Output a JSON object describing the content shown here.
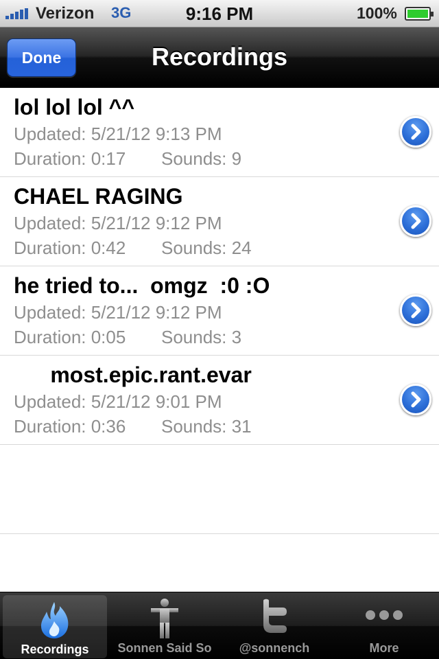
{
  "status_bar": {
    "carrier": "Verizon",
    "network": "3G",
    "time": "9:16 PM",
    "battery": "100%"
  },
  "nav": {
    "done_label": "Done",
    "title": "Recordings"
  },
  "recordings": [
    {
      "title": "lol lol lol ^^",
      "updated": "Updated: 5/21/12 9:13 PM",
      "duration": "Duration: 0:17",
      "sounds": "Sounds: 9"
    },
    {
      "title": "CHAEL RAGING",
      "updated": "Updated: 5/21/12 9:12 PM",
      "duration": "Duration: 0:42",
      "sounds": "Sounds: 24"
    },
    {
      "title": "he tried to...  omgz  :0 :O",
      "updated": "Updated: 5/21/12 9:12 PM",
      "duration": "Duration: 0:05",
      "sounds": "Sounds: 3"
    },
    {
      "title": "      most.epic.rant.evar",
      "updated": "Updated: 5/21/12 9:01 PM",
      "duration": "Duration: 0:36",
      "sounds": "Sounds: 31"
    }
  ],
  "tabs": [
    {
      "label": "Recordings",
      "icon": "flame-icon",
      "selected": true
    },
    {
      "label": "Sonnen Said So",
      "icon": "person-icon",
      "selected": false
    },
    {
      "label": "@sonnench",
      "icon": "twitter-icon",
      "selected": false
    },
    {
      "label": "More",
      "icon": "more-dots-icon",
      "selected": false
    }
  ],
  "colors": {
    "accent_blue": "#2d6fd8",
    "secondary_text": "#8e8e8e",
    "tab_selected_label": "#ffffff"
  }
}
